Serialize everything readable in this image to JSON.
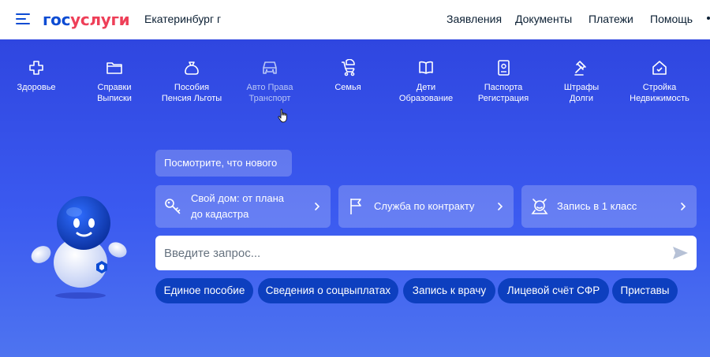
{
  "header": {
    "logo_part1": "гос",
    "logo_part2": "услуги",
    "city": "Екатеринбург г",
    "nav": [
      "Заявления",
      "Документы",
      "Платежи",
      "Помощь"
    ]
  },
  "categories": [
    {
      "icon": "cross-icon",
      "line1": "Здоровье",
      "line2": ""
    },
    {
      "icon": "folder-icon",
      "line1": "Справки",
      "line2": "Выписки"
    },
    {
      "icon": "money-bag-icon",
      "line1": "Пособия",
      "line2": "Пенсия Льготы"
    },
    {
      "icon": "car-icon",
      "line1": "Авто Права",
      "line2": "Транспорт"
    },
    {
      "icon": "stroller-icon",
      "line1": "Семья",
      "line2": ""
    },
    {
      "icon": "book-icon",
      "line1": "Дети",
      "line2": "Образование"
    },
    {
      "icon": "passport-icon",
      "line1": "Паспорта",
      "line2": "Регистрация"
    },
    {
      "icon": "gavel-icon",
      "line1": "Штрафы",
      "line2": "Долги"
    },
    {
      "icon": "house-icon",
      "line1": "Стройка",
      "line2": "Недвижимость"
    }
  ],
  "whats_new": "Посмотрите, что нового",
  "cards": [
    {
      "icon": "key-icon",
      "line1": "Свой дом: от плана",
      "line2": "до кадастра"
    },
    {
      "icon": "flag-icon",
      "line1": "Служба по контракту",
      "line2": ""
    },
    {
      "icon": "school-child-icon",
      "line1": "Запись в 1 класс",
      "line2": ""
    }
  ],
  "search": {
    "placeholder": "Введите запрос..."
  },
  "quick_links": [
    "Единое пособие",
    "Сведения о соцвыплатах",
    "Запись к врачу",
    "Лицевой счёт СФР",
    "Приставы"
  ],
  "colors": {
    "brand_blue": "#0d4cd3",
    "brand_red": "#ee3f58",
    "hero_blue": "#3b5af0",
    "pill_blue": "#0d3fbf"
  }
}
